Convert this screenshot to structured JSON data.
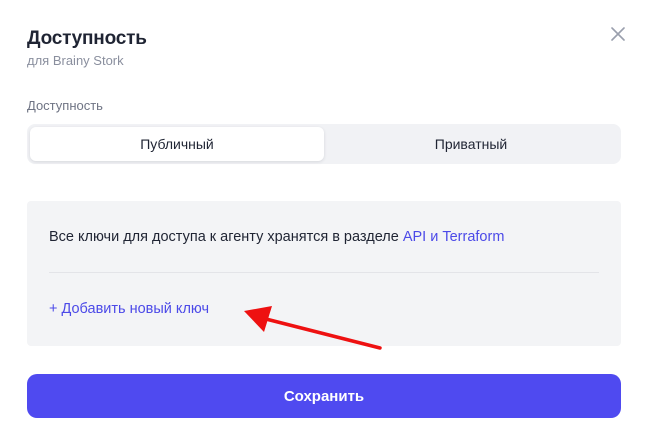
{
  "dialog": {
    "title": "Доступность",
    "subtitle": "для Brainy Stork"
  },
  "access": {
    "label": "Доступность",
    "options": [
      {
        "label": "Публичный",
        "selected": true
      },
      {
        "label": "Приватный",
        "selected": false
      }
    ]
  },
  "keys": {
    "info_text": "Все ключи для доступа к агенту хранятся в разделе",
    "info_link": "API и Terraform",
    "add_key_label": "+ Добавить новый ключ"
  },
  "actions": {
    "save_label": "Сохранить"
  },
  "colors": {
    "accent": "#4f4af0",
    "link": "#4c4ae8",
    "annotation_arrow": "#ee1111"
  }
}
